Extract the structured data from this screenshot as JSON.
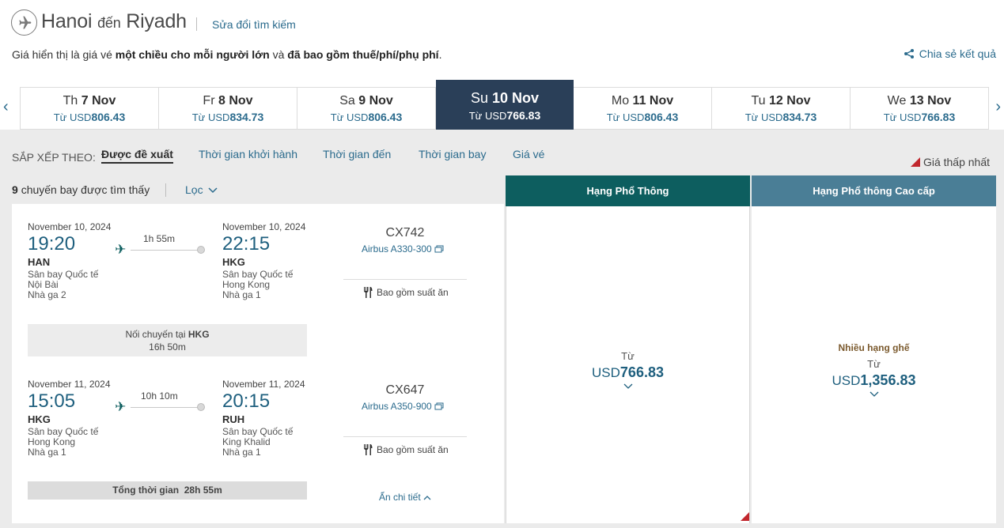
{
  "header": {
    "origin": "Hanoi",
    "connector": "đến",
    "destination": "Riyadh",
    "modify_search": "Sửa đổi tìm kiếm",
    "info_prefix": "Giá hiển thị là giá vé",
    "info_bold1": "một chiều cho mỗi người lớn",
    "info_mid": "và",
    "info_bold2": "đã bao gồm thuế/phí/phụ phí",
    "info_end": ".",
    "share": "Chia sẻ kết quả"
  },
  "dates": [
    {
      "dow": "Th",
      "day": "7 Nov",
      "from": "Từ USD",
      "price": "806.43"
    },
    {
      "dow": "Fr",
      "day": "8 Nov",
      "from": "Từ USD",
      "price": "834.73"
    },
    {
      "dow": "Sa",
      "day": "9 Nov",
      "from": "Từ USD",
      "price": "806.43"
    },
    {
      "dow": "Su",
      "day": "10 Nov",
      "from": "Từ USD",
      "price": "766.83"
    },
    {
      "dow": "Mo",
      "day": "11 Nov",
      "from": "Từ USD",
      "price": "806.43"
    },
    {
      "dow": "Tu",
      "day": "12 Nov",
      "from": "Từ USD",
      "price": "834.73"
    },
    {
      "dow": "We",
      "day": "13 Nov",
      "from": "Từ USD",
      "price": "766.83"
    }
  ],
  "sort": {
    "label": "SẮP XẾP THEO:",
    "options": [
      "Được đề xuất",
      "Thời gian khởi hành",
      "Thời gian đến",
      "Thời gian bay",
      "Giá vé"
    ],
    "lowest": "Giá thấp nhất"
  },
  "results": {
    "count": "9",
    "count_text": "chuyến bay được tìm thấy",
    "filter": "Lọc"
  },
  "cabins": {
    "economy": "Hạng Phổ Thông",
    "premium": "Hạng Phổ thông Cao cấp"
  },
  "legs": [
    {
      "dep_date": "November 10, 2024",
      "dep_time": "19:20",
      "dep_code": "HAN",
      "dep_airport1": "Sân bay Quốc tế",
      "dep_airport2": "Nội Bài",
      "dep_terminal": "Nhà ga 2",
      "duration": "1h 55m",
      "arr_date": "November 10, 2024",
      "arr_time": "22:15",
      "arr_code": "HKG",
      "arr_airport1": "Sân bay Quốc tế",
      "arr_airport2": "Hong Kong",
      "arr_terminal": "Nhà ga 1",
      "flight_no": "CX742",
      "aircraft": "Airbus A330-300",
      "meal": "Bao gồm suất ăn"
    },
    {
      "dep_date": "November 11, 2024",
      "dep_time": "15:05",
      "dep_code": "HKG",
      "dep_airport1": "Sân bay Quốc tế",
      "dep_airport2": "Hong Kong",
      "dep_terminal": "Nhà ga 1",
      "duration": "10h 10m",
      "arr_date": "November 11, 2024",
      "arr_time": "20:15",
      "arr_code": "RUH",
      "arr_airport1": "Sân bay Quốc tế",
      "arr_airport2": "King Khalid",
      "arr_terminal": "Nhà ga 1",
      "flight_no": "CX647",
      "aircraft": "Airbus A350-900",
      "meal": "Bao gồm suất ăn"
    }
  ],
  "connection": {
    "label": "Nối chuyến tại",
    "airport": "HKG",
    "duration": "16h 50m"
  },
  "total": {
    "label": "Tổng thời gian",
    "value": "28h 55m"
  },
  "hide_details": "Ẩn chi tiết",
  "prices": {
    "economy_from": "Từ",
    "economy_currency": "USD",
    "economy_value": "766.83",
    "premium_note": "Nhiều hạng ghế",
    "premium_from": "Từ",
    "premium_currency": "USD",
    "premium_value": "1,356.83"
  },
  "colors": {
    "accent": "#2b6b8d",
    "economy_header": "#0d5e5f",
    "premium_header": "#4a7e96",
    "active_date": "#2a3f58",
    "lowest_marker": "#c1272d"
  }
}
